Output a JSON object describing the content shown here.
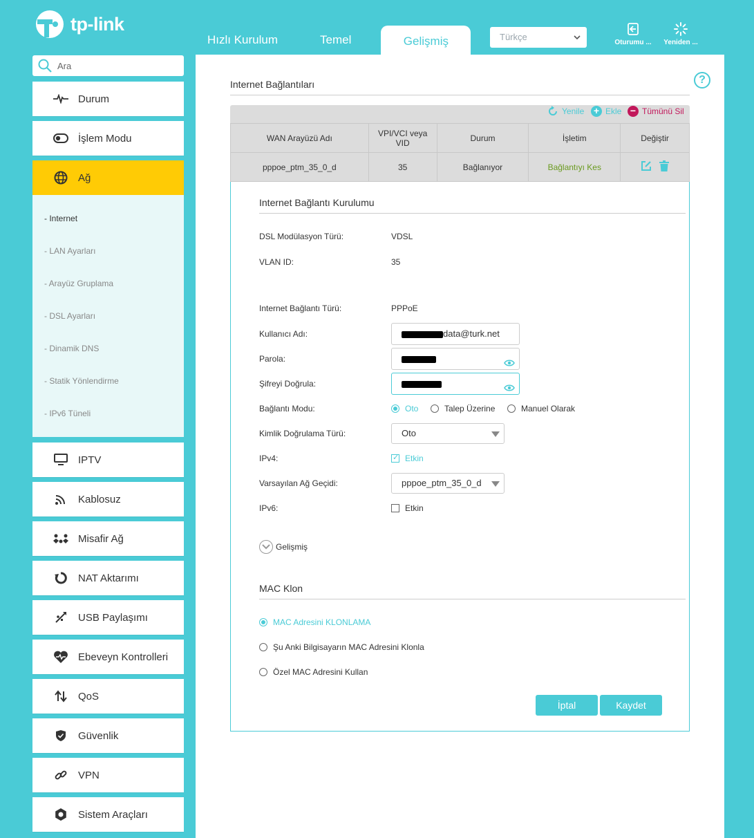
{
  "brand": {
    "name": "tp-link"
  },
  "top_tabs": [
    {
      "label": "Hızlı Kurulum"
    },
    {
      "label": "Temel"
    },
    {
      "label": "Gelişmiş"
    }
  ],
  "language": {
    "selected": "Türkçe"
  },
  "header_buttons": {
    "logout": "Oturumu ...",
    "reboot": "Yeniden ..."
  },
  "search": {
    "placeholder": "Ara"
  },
  "sidebar": {
    "items": [
      {
        "label": "Durum",
        "icon": "pulse-icon"
      },
      {
        "label": "İşlem Modu",
        "icon": "toggle-icon"
      },
      {
        "label": "Ağ",
        "icon": "globe-icon"
      },
      {
        "label": "IPTV",
        "icon": "monitor-icon"
      },
      {
        "label": "Kablosuz",
        "icon": "wifi-icon"
      },
      {
        "label": "Misafir Ağ",
        "icon": "guests-icon"
      },
      {
        "label": "NAT Aktarımı",
        "icon": "nat-icon"
      },
      {
        "label": "USB Paylaşımı",
        "icon": "usb-icon"
      },
      {
        "label": "Ebeveyn Kontrolleri",
        "icon": "heart-icon"
      },
      {
        "label": "QoS",
        "icon": "arrows-icon"
      },
      {
        "label": "Güvenlik",
        "icon": "shield-icon"
      },
      {
        "label": "VPN",
        "icon": "link-icon"
      },
      {
        "label": "Sistem Araçları",
        "icon": "gear-icon"
      }
    ],
    "sub_items": [
      {
        "label": "- Internet"
      },
      {
        "label": "- LAN Ayarları"
      },
      {
        "label": "- Arayüz Gruplama"
      },
      {
        "label": "- DSL Ayarları"
      },
      {
        "label": "- Dinamik DNS"
      },
      {
        "label": "- Statik Yönlendirme"
      },
      {
        "label": "- IPv6 Tüneli"
      }
    ]
  },
  "main": {
    "title": "Internet Bağlantıları",
    "toolbar": {
      "refresh": "Yenile",
      "add": "Ekle",
      "delete_all": "Tümünü Sil"
    },
    "table": {
      "headers": [
        "WAN Arayüzü Adı",
        "VPI/VCI veya VID",
        "Durum",
        "İşletim",
        "Değiştir"
      ],
      "rows": [
        {
          "name": "pppoe_ptm_35_0_d",
          "vid": "35",
          "status": "Bağlanıyor",
          "action": "Bağlantıyı Kes"
        }
      ]
    },
    "setup": {
      "title": "Internet Bağlantı Kurulumu",
      "dsl_mod_label": "DSL Modülasyon Türü:",
      "dsl_mod_value": "VDSL",
      "vlan_label": "VLAN ID:",
      "vlan_value": "35",
      "conn_type_label": "Internet Bağlantı Türü:",
      "conn_type_value": "PPPoE",
      "username_label": "Kullanıcı Adı:",
      "username_value": "data@turk.net",
      "password_label": "Parola:",
      "confirm_label": "Şifreyi Doğrula:",
      "conn_mode_label": "Bağlantı Modu:",
      "conn_mode_options": [
        "Oto",
        "Talep Üzerine",
        "Manuel Olarak"
      ],
      "auth_label": "Kimlik Doğrulama Türü:",
      "auth_value": "Oto",
      "ipv4_label": "IPv4:",
      "ipv4_option": "Etkin",
      "gateway_label": "Varsayılan Ağ Geçidi:",
      "gateway_value": "pppoe_ptm_35_0_d",
      "ipv6_label": "IPv6:",
      "ipv6_option": "Etkin",
      "advanced": "Gelişmiş"
    },
    "mac": {
      "title": "MAC Klon",
      "options": [
        "MAC Adresini KLONLAMA",
        "Şu Anki Bilgisayarın MAC Adresini Klonla",
        "Özel MAC Adresini Kullan"
      ]
    },
    "buttons": {
      "cancel": "İptal",
      "save": "Kaydet"
    }
  },
  "colors": {
    "accent": "#4acbd6",
    "active_nav": "#ffcb05",
    "danger": "#c2185b",
    "connect_action": "#6a9a1f"
  }
}
